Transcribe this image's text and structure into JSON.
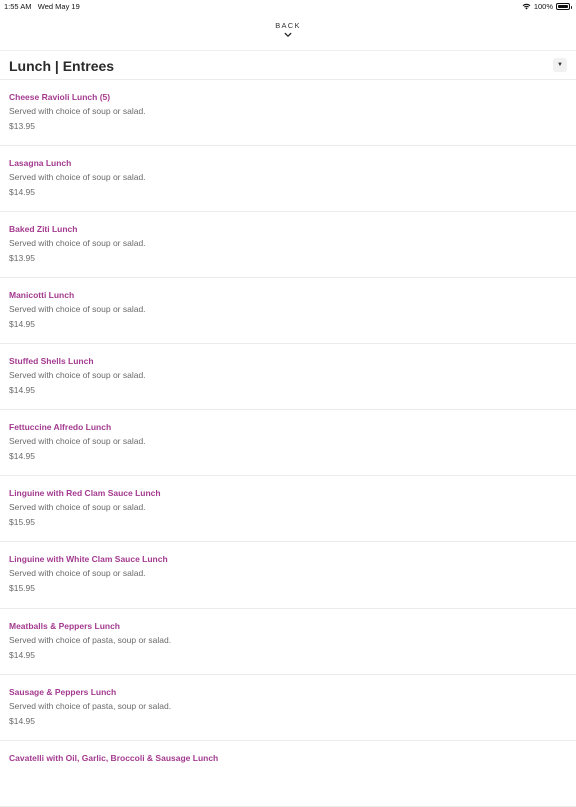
{
  "status_bar": {
    "time": "1:55 AM",
    "date": "Wed May 19",
    "battery": "100%"
  },
  "nav": {
    "back_label": "BACK"
  },
  "category": {
    "title": "Lunch | Entrees"
  },
  "items": [
    {
      "name": "Cheese Ravioli Lunch (5)",
      "description": "Served with choice of soup or salad.",
      "price": "$13.95"
    },
    {
      "name": "Lasagna Lunch",
      "description": "Served with choice of soup or salad.",
      "price": "$14.95"
    },
    {
      "name": "Baked Ziti Lunch",
      "description": "Served with choice of soup or salad.",
      "price": "$13.95"
    },
    {
      "name": "Manicotti Lunch",
      "description": "Served with choice of soup or salad.",
      "price": "$14.95"
    },
    {
      "name": "Stuffed Shells Lunch",
      "description": "Served with choice of soup or salad.",
      "price": "$14.95"
    },
    {
      "name": "Fettuccine Alfredo Lunch",
      "description": "Served with choice of soup or salad.",
      "price": "$14.95"
    },
    {
      "name": "Linguine with Red Clam Sauce Lunch",
      "description": "Served with choice of soup or salad.",
      "price": "$15.95"
    },
    {
      "name": "Linguine with White Clam Sauce Lunch",
      "description": "Served with choice of soup or salad.",
      "price": "$15.95"
    },
    {
      "name": "Meatballs & Peppers Lunch",
      "description": "Served with choice of pasta, soup or salad.",
      "price": "$14.95"
    },
    {
      "name": "Sausage & Peppers Lunch",
      "description": "Served with choice of pasta, soup or salad.",
      "price": "$14.95"
    },
    {
      "name": "Cavatelli with Oil, Garlic, Broccoli & Sausage Lunch",
      "description": "",
      "price": ""
    }
  ],
  "colors": {
    "accent": "#a33a8f",
    "muted_text": "#6a6a6a"
  }
}
